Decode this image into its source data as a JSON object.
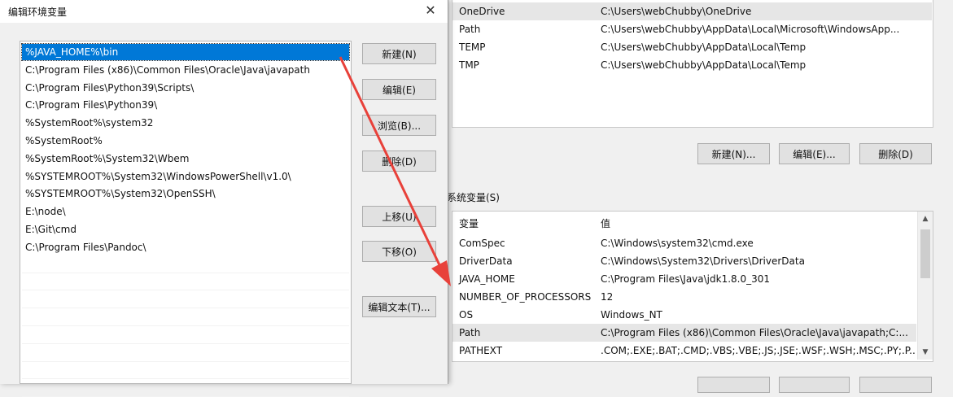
{
  "background": {
    "user_vars": [
      {
        "name": "OneDrive",
        "value": "C:\\Users\\webChubby\\OneDrive",
        "selected": true
      },
      {
        "name": "Path",
        "value": "C:\\Users\\webChubby\\AppData\\Local\\Microsoft\\WindowsApp..."
      },
      {
        "name": "TEMP",
        "value": "C:\\Users\\webChubby\\AppData\\Local\\Temp"
      },
      {
        "name": "TMP",
        "value": "C:\\Users\\webChubby\\AppData\\Local\\Temp"
      }
    ],
    "user_buttons": {
      "new": "新建(N)...",
      "edit": "编辑(E)...",
      "delete": "删除(D)"
    },
    "system_label": "系统变量(S)",
    "system_header": {
      "name": "变量",
      "value": "值"
    },
    "system_vars": [
      {
        "name": "ComSpec",
        "value": "C:\\Windows\\system32\\cmd.exe"
      },
      {
        "name": "DriverData",
        "value": "C:\\Windows\\System32\\Drivers\\DriverData"
      },
      {
        "name": "JAVA_HOME",
        "value": "C:\\Program Files\\Java\\jdk1.8.0_301"
      },
      {
        "name": "NUMBER_OF_PROCESSORS",
        "value": "12"
      },
      {
        "name": "OS",
        "value": "Windows_NT"
      },
      {
        "name": "Path",
        "value": "C:\\Program Files (x86)\\Common Files\\Oracle\\Java\\javapath;C:...",
        "selected": true
      },
      {
        "name": "PATHEXT",
        "value": ".COM;.EXE;.BAT;.CMD;.VBS;.VBE;.JS;.JSE;.WSF;.WSH;.MSC;.PY;.P..."
      }
    ]
  },
  "dialog": {
    "title": "编辑环境变量",
    "close_glyph": "✕",
    "paths": [
      "%JAVA_HOME%\\bin",
      "C:\\Program Files (x86)\\Common Files\\Oracle\\Java\\javapath",
      "C:\\Program Files\\Python39\\Scripts\\",
      "C:\\Program Files\\Python39\\",
      "%SystemRoot%\\system32",
      "%SystemRoot%",
      "%SystemRoot%\\System32\\Wbem",
      "%SYSTEMROOT%\\System32\\WindowsPowerShell\\v1.0\\",
      "%SYSTEMROOT%\\System32\\OpenSSH\\",
      "E:\\node\\",
      "E:\\Git\\cmd",
      "C:\\Program Files\\Pandoc\\"
    ],
    "selected_index": 0,
    "buttons": {
      "new": "新建(N)",
      "edit": "编辑(E)",
      "browse": "浏览(B)...",
      "delete": "删除(D)",
      "move_up": "上移(U)",
      "move_down": "下移(O)",
      "edit_text": "编辑文本(T)..."
    }
  },
  "colors": {
    "selection": "#0078d7",
    "arrow": "#e8413a"
  }
}
